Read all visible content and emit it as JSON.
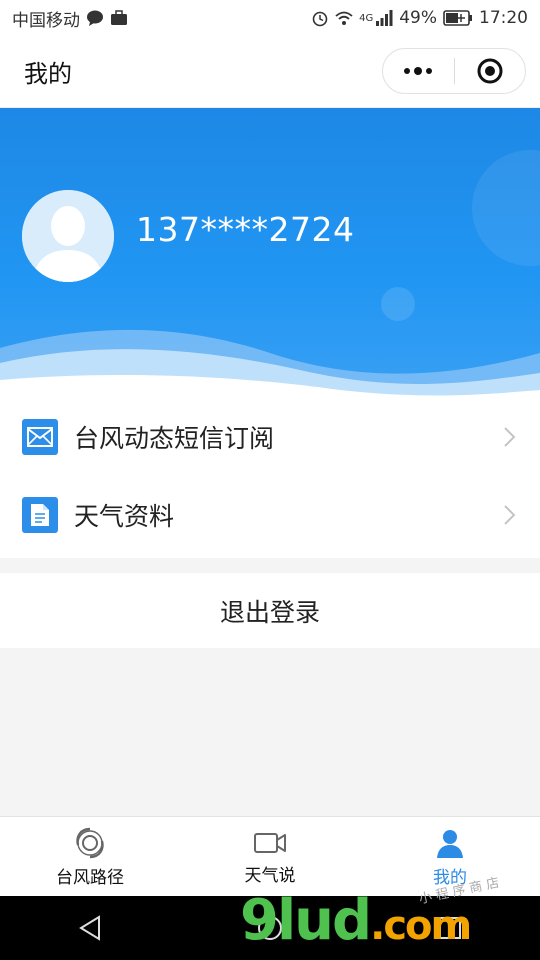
{
  "status_bar": {
    "carrier": "中国移动",
    "network": "4G",
    "battery": "49%",
    "time": "17:20"
  },
  "nav": {
    "title": "我的"
  },
  "profile": {
    "phone": "137****2724"
  },
  "menu": [
    {
      "label": "台风动态短信订阅",
      "icon": "mail-icon"
    },
    {
      "label": "天气资料",
      "icon": "document-icon"
    }
  ],
  "logout_label": "退出登录",
  "tabs": [
    {
      "label": "台风路径",
      "icon": "typhoon-icon",
      "active": false
    },
    {
      "label": "天气说",
      "icon": "video-icon",
      "active": false
    },
    {
      "label": "我的",
      "icon": "user-icon",
      "active": true
    }
  ],
  "watermark": {
    "main": "9lud",
    "suffix": ".com",
    "small": "小 程 序 商 店"
  },
  "colors": {
    "accent": "#2b8be5",
    "hero": "#1e88e5"
  }
}
